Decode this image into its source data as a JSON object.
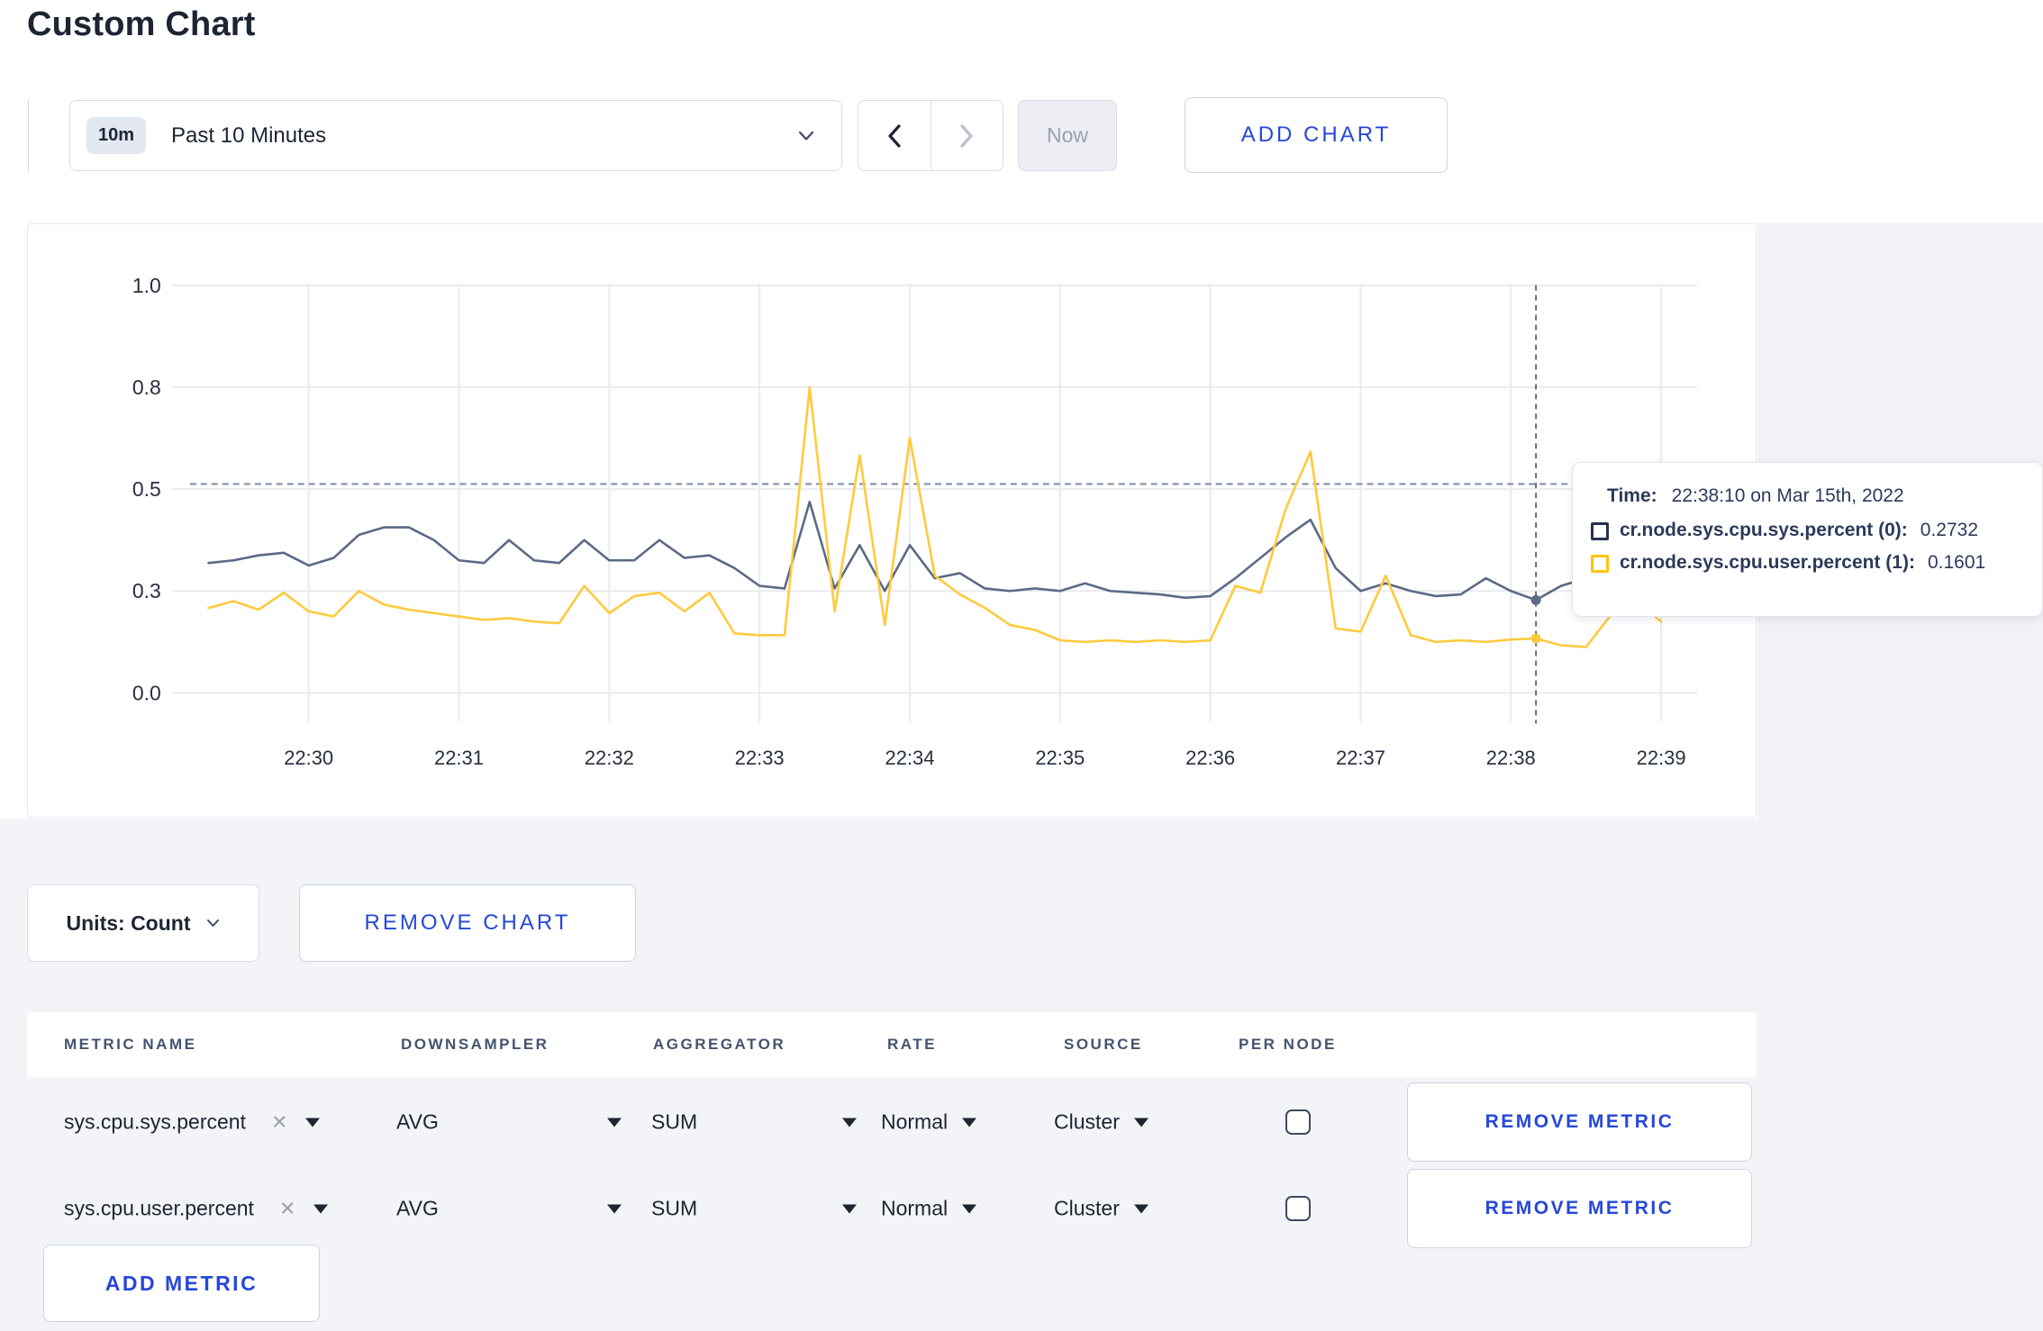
{
  "page": {
    "title": "Custom Chart",
    "accent_blue": "#2647d9",
    "background_gray": "#f3f4f8"
  },
  "toolbar": {
    "time_window_badge": "10m",
    "time_window_label": "Past 10 Minutes",
    "now_label": "Now",
    "add_chart_label": "ADD CHART"
  },
  "chart_data": {
    "type": "line",
    "title": "",
    "xlabel": "",
    "ylabel": "",
    "grid": true,
    "x_axis": {
      "tick_minutes": [
        0,
        1,
        2,
        3,
        4,
        5,
        6,
        7,
        8,
        9
      ],
      "tick_labels": [
        "22:30",
        "22:31",
        "22:32",
        "22:33",
        "22:34",
        "22:35",
        "22:36",
        "22:37",
        "22:38",
        "22:39"
      ]
    },
    "y_axis": {
      "tick_values": [
        0.0,
        0.3,
        0.5,
        0.8,
        1.0
      ],
      "tick_labels": [
        "0.0",
        "0.3",
        "0.5",
        "0.8",
        "1.0"
      ]
    },
    "dashed_guideline_value": 0.515,
    "crosshair": {
      "time_sec_from_2230": 490,
      "label": "22:38:10"
    },
    "times_sec_from_2230": [
      -40,
      -30,
      -20,
      -10,
      0,
      10,
      20,
      30,
      40,
      50,
      60,
      70,
      80,
      90,
      100,
      110,
      120,
      130,
      140,
      150,
      160,
      170,
      180,
      190,
      200,
      210,
      220,
      230,
      240,
      250,
      260,
      270,
      280,
      290,
      300,
      310,
      320,
      330,
      340,
      350,
      360,
      370,
      380,
      390,
      400,
      410,
      420,
      430,
      440,
      450,
      460,
      470,
      480,
      490,
      500,
      510,
      520,
      530,
      540
    ],
    "series": [
      {
        "name": "cr.node.sys.cpu.sys.percent (0)",
        "color": "#5b6a85",
        "values": [
          0.355,
          0.36,
          0.37,
          0.375,
          0.35,
          0.365,
          0.41,
          0.425,
          0.425,
          0.4,
          0.36,
          0.355,
          0.4,
          0.36,
          0.355,
          0.4,
          0.36,
          0.36,
          0.4,
          0.365,
          0.37,
          0.345,
          0.31,
          0.305,
          0.475,
          0.305,
          0.39,
          0.3,
          0.39,
          0.325,
          0.335,
          0.305,
          0.3,
          0.305,
          0.3,
          0.315,
          0.3,
          0.295,
          0.29,
          0.28,
          0.285,
          0.325,
          0.365,
          0.405,
          0.44,
          0.345,
          0.3,
          0.315,
          0.3,
          0.285,
          0.29,
          0.325,
          0.3,
          0.2732,
          0.31,
          0.325,
          0.3,
          0.295,
          0.3
        ]
      },
      {
        "name": "cr.node.sys.cpu.user.percent (1)",
        "color": "#ffca3d",
        "values": [
          0.25,
          0.27,
          0.245,
          0.295,
          0.24,
          0.225,
          0.3,
          0.26,
          0.245,
          0.235,
          0.225,
          0.215,
          0.22,
          0.21,
          0.205,
          0.31,
          0.235,
          0.285,
          0.295,
          0.24,
          0.295,
          0.175,
          0.17,
          0.17,
          0.8,
          0.24,
          0.6,
          0.2,
          0.65,
          0.33,
          0.29,
          0.25,
          0.2,
          0.185,
          0.155,
          0.15,
          0.155,
          0.15,
          0.155,
          0.15,
          0.155,
          0.31,
          0.295,
          0.46,
          0.61,
          0.19,
          0.18,
          0.33,
          0.17,
          0.15,
          0.155,
          0.15,
          0.157,
          0.1601,
          0.14,
          0.135,
          0.23,
          0.27,
          0.21
        ]
      }
    ]
  },
  "tooltip": {
    "time_label": "Time:",
    "time_value": "22:38:10 on Mar 15th, 2022",
    "series": [
      {
        "name": "cr.node.sys.cpu.sys.percent (0):",
        "value": "0.2732",
        "color": "#26324f"
      },
      {
        "name": "cr.node.sys.cpu.user.percent (1):",
        "value": "0.1601",
        "color": "#ffc312"
      }
    ]
  },
  "units_bar": {
    "units_label": "Units: Count",
    "remove_chart_label": "REMOVE CHART"
  },
  "metrics_table": {
    "columns": [
      "METRIC NAME",
      "DOWNSAMPLER",
      "AGGREGATOR",
      "RATE",
      "SOURCE",
      "PER NODE"
    ],
    "rows": [
      {
        "metric_name": "sys.cpu.sys.percent",
        "downsampler": "AVG",
        "aggregator": "SUM",
        "rate": "Normal",
        "source": "Cluster",
        "per_node_checked": false,
        "remove_label": "REMOVE METRIC"
      },
      {
        "metric_name": "sys.cpu.user.percent",
        "downsampler": "AVG",
        "aggregator": "SUM",
        "rate": "Normal",
        "source": "Cluster",
        "per_node_checked": false,
        "remove_label": "REMOVE METRIC"
      }
    ],
    "add_metric_label": "ADD METRIC"
  }
}
